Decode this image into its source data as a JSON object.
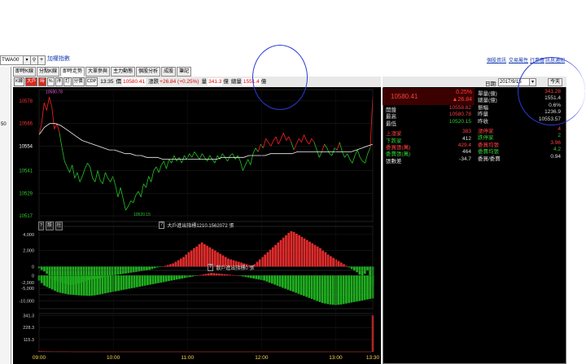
{
  "toolbar": {
    "symbol": "TWA00",
    "symbol_name": "加權指數",
    "links": [
      "個股資訊",
      "交易屬性",
      "行事曆",
      "訊息通知"
    ]
  },
  "left_edge": {
    "text": "50"
  },
  "tabs": [
    "即時K線",
    "分點K線",
    "即時走勢",
    "大單參與",
    "主力動態",
    "個股分析",
    "成股",
    "筆記"
  ],
  "active_tab": 2,
  "chart_toolbar": {
    "buttons": [
      "K線",
      "大戶",
      "時",
      "%",
      "洋",
      "訂",
      "分價",
      "CDP"
    ],
    "time": "13:35",
    "price_label": "價",
    "price": "10580.41",
    "change_label": "漲跌",
    "change": "+26.84 (+0.25%)",
    "vol_label": "量",
    "vol": "341.3",
    "vol_unit": "億",
    "total_label": "總量",
    "total": "1551.4",
    "total_unit": "億"
  },
  "chart_data": [
    {
      "type": "line",
      "x_ticks": [
        "09:00",
        "10:00",
        "11:00",
        "12:00",
        "13:00",
        "13:30"
      ],
      "y_ticks": [
        10517,
        10529,
        10541,
        10554,
        10566,
        10578
      ],
      "ylim": [
        10514,
        10584
      ],
      "annotations": [
        "10580.78",
        "10520.15"
      ],
      "series": [
        {
          "values": [
            10560,
            10566,
            10577,
            10573,
            10580,
            10575,
            10563,
            10566,
            10561,
            10553,
            10546,
            10543,
            10540,
            10544,
            10537,
            10540,
            10535,
            10538,
            10542,
            10545,
            10543,
            10537,
            10535,
            10541,
            10536,
            10534,
            10540,
            10537,
            10535,
            10538,
            10533,
            10527,
            10532,
            10526,
            10520,
            10522,
            10525,
            10524,
            10528,
            10530,
            10527,
            10534,
            10532,
            10538,
            10535,
            10541,
            10543,
            10540,
            10544,
            10546,
            10542,
            10547,
            10545,
            10549,
            10546,
            10548,
            10545,
            10549,
            10547,
            10550,
            10548,
            10551,
            10549,
            10547,
            10550,
            10548,
            10546,
            10549,
            10547,
            10545,
            10549,
            10547,
            10550,
            10548,
            10546,
            10549,
            10550,
            10547,
            10549,
            10546,
            10541,
            10544,
            10547,
            10544,
            10550,
            10553,
            10551,
            10555,
            10553,
            10558,
            10556,
            10554,
            10557,
            10559,
            10555,
            10558,
            10561,
            10557,
            10559,
            10556,
            10552,
            10555,
            10558,
            10556,
            10560,
            10557,
            10555,
            10558,
            10556,
            10552,
            10548,
            10551,
            10555,
            10553,
            10550,
            10549,
            10553,
            10552,
            10556,
            10551,
            10548,
            10550,
            10547,
            10545,
            10549,
            10552,
            10548,
            10546,
            10545,
            10550,
            10553,
            10580
          ]
        },
        {
          "values": [
            10560,
            10564,
            10566,
            10566,
            10565,
            10563,
            10561,
            10559,
            10557,
            10556,
            10555,
            10554,
            10553,
            10552,
            10552,
            10551,
            10550,
            10550,
            10549,
            10549,
            10548,
            10548,
            10548,
            10547,
            10547,
            10547,
            10547,
            10547,
            10547,
            10547,
            10547,
            10547,
            10547,
            10547,
            10548,
            10548,
            10548,
            10548,
            10548,
            10549,
            10549,
            10549,
            10549,
            10550,
            10550,
            10550,
            10550,
            10550,
            10551,
            10551,
            10551,
            10551,
            10551,
            10551,
            10551,
            10551,
            10551,
            10551,
            10551,
            10552,
            10553,
            10554,
            10555
          ]
        }
      ]
    },
    {
      "type": "bar",
      "title": "大戶進出指標",
      "y_ticks": [
        4000,
        2000,
        0,
        -2000
      ],
      "ylim": [
        -3500,
        5000
      ],
      "values": [
        -200,
        -400,
        -600,
        -900,
        -1200,
        -1500,
        -1700,
        -1800,
        -1900,
        -2000,
        -2100,
        -2200,
        -2300,
        -2250,
        -2200,
        -2100,
        -2050,
        -1900,
        -1800,
        -1700,
        -1600,
        -1550,
        -1500,
        -1450,
        -1400,
        -1300,
        -1250,
        -1200,
        -1100,
        -1050,
        -1000,
        -950,
        -900,
        -850,
        -800,
        -750,
        -700,
        -650,
        -600,
        -550,
        -500,
        -450,
        -400,
        -300,
        -200,
        -100,
        -50,
        50,
        100,
        200,
        300,
        400,
        600,
        800,
        1000,
        1200,
        1500,
        1800,
        2000,
        2300,
        2500,
        2800,
        3000,
        2800,
        2600,
        2400,
        2200,
        2000,
        1800,
        1600,
        1400,
        1200,
        1000,
        900,
        800,
        700,
        600,
        500,
        400,
        300,
        200,
        100,
        300,
        600,
        900,
        1200,
        1500,
        1800,
        2100,
        2400,
        2700,
        3000,
        3300,
        3600,
        3900,
        4200,
        4400,
        4300,
        4100,
        3900,
        3700,
        3500,
        3300,
        3100,
        2900,
        2700,
        2500,
        2300,
        2000,
        1800,
        1500,
        1300,
        1100,
        900,
        700,
        500,
        300,
        100,
        -100,
        -300,
        -500,
        -700,
        -1000,
        -1300,
        -900,
        -500,
        -1200,
        -2400
      ]
    },
    {
      "type": "bar",
      "title": "散戶進出指標",
      "y_ticks": [
        0,
        -5000,
        -10000
      ],
      "ylim": [
        -13000,
        2000
      ],
      "values": [
        -2000,
        -3000,
        -4000,
        -4500,
        -5000,
        -5500,
        -6000,
        -6500,
        -6800,
        -7000,
        -7200,
        -7400,
        -7500,
        -7600,
        -7700,
        -7800,
        -7850,
        -7900,
        -7950,
        -8000,
        -7900,
        -7800,
        -7600,
        -7400,
        -7200,
        -7000,
        -6800,
        -6600,
        -6400,
        -6200,
        -6000,
        -5800,
        -5600,
        -5400,
        -5200,
        -5000,
        -4800,
        -4600,
        -4400,
        -4200,
        -4000,
        -3800,
        -3600,
        -3400,
        -3200,
        -3000,
        -2800,
        -2600,
        -2400,
        -2200,
        -2000,
        -1800,
        -1600,
        -1400,
        -1200,
        -1000,
        -800,
        -600,
        -400,
        -200,
        0,
        200,
        400,
        600,
        800,
        1000,
        900,
        800,
        700,
        600,
        500,
        400,
        300,
        200,
        100,
        0,
        -200,
        -400,
        -600,
        -800,
        -1000,
        -1200,
        -1400,
        -1600,
        -1800,
        -2000,
        -2400,
        -2800,
        -3200,
        -3600,
        -4000,
        -4400,
        -4800,
        -5200,
        -5600,
        -6000,
        -6400,
        -6800,
        -7200,
        -7600,
        -8000,
        -8400,
        -8800,
        -9200,
        -9600,
        -10000,
        -10400,
        -10800,
        -11000,
        -11200,
        -11400,
        -11500,
        -11600,
        -11500,
        -11400,
        -11200,
        -11000,
        -10800,
        -10600,
        -10400,
        -10200,
        -10000,
        -9800,
        -9600,
        -9400,
        -9200,
        -9000
      ]
    },
    {
      "type": "bar",
      "y_ticks": [
        341.3,
        228.3,
        115.3
      ],
      "ylim": [
        0,
        360
      ],
      "values": [
        8,
        6,
        5,
        4,
        4,
        3,
        3,
        3,
        3,
        3,
        3,
        3,
        3,
        2,
        2,
        2,
        2,
        2,
        2,
        2,
        2,
        2,
        2,
        2,
        2,
        2,
        2,
        2,
        2,
        2,
        2,
        2,
        2,
        2,
        2,
        2,
        2,
        2,
        2,
        2,
        2,
        2,
        2,
        2,
        2,
        2,
        2,
        2,
        2,
        2,
        2,
        2,
        2,
        2,
        2,
        2,
        2,
        2,
        2,
        2,
        2,
        2,
        2,
        2,
        2,
        2,
        2,
        2,
        2,
        2,
        2,
        2,
        2,
        2,
        2,
        2,
        2,
        2,
        2,
        2,
        2,
        2,
        2,
        2,
        2,
        2,
        2,
        2,
        2,
        2,
        2,
        2,
        2,
        2,
        2,
        2,
        2,
        2,
        2,
        2,
        2,
        2,
        2,
        2,
        2,
        2,
        2,
        2,
        2,
        2,
        2,
        2,
        2,
        2,
        2,
        2,
        2,
        2,
        2,
        2,
        2,
        2,
        2,
        2,
        2,
        2,
        2,
        2,
        2,
        2,
        2,
        341.3
      ]
    }
  ],
  "sub_panel_1": {
    "buttons": [
      "?",
      "設",
      "社"
    ],
    "help": "?",
    "title": "大戶進出指標1210.1562072 張"
  },
  "sub_panel_2": {
    "help": "?",
    "title": "散戶進出指標0 張"
  },
  "right_panel": {
    "date_label": "日期:",
    "date_value": "2017/9/15",
    "today_btn": "今天",
    "big_price": "10580.41",
    "pct": "0.25%",
    "change": "▲26.84",
    "rows_left": [
      {
        "label": "開盤",
        "value": "10558.82"
      },
      {
        "label": "最高",
        "value": "10580.78"
      },
      {
        "label": "最低",
        "value": "10520.15"
      },
      {
        "label": "上漲家",
        "value": "383"
      },
      {
        "label": "下跌家",
        "value": "412"
      },
      {
        "label": "委買張(萬)",
        "value": "429.4"
      },
      {
        "label": "委賣張(萬)",
        "value": "464"
      },
      {
        "label": "張數差",
        "value": "-34.7"
      }
    ],
    "rows_right": [
      {
        "label": "單量(億)",
        "value": "341.28"
      },
      {
        "label": "總量(億)",
        "value": "1551.4"
      },
      {
        "label": "振幅",
        "value": "0.6%"
      },
      {
        "label": "昨量",
        "value": "1236.9"
      },
      {
        "label": "昨收",
        "value": "10553.57"
      },
      {
        "label": "漲停家",
        "value": "4"
      },
      {
        "label": "跌停家",
        "value": "2"
      },
      {
        "label": "委買均張",
        "value": "3.96"
      },
      {
        "label": "委賣均張",
        "value": "4.2"
      },
      {
        "label": "委買/委賣",
        "value": "0.94"
      }
    ]
  }
}
